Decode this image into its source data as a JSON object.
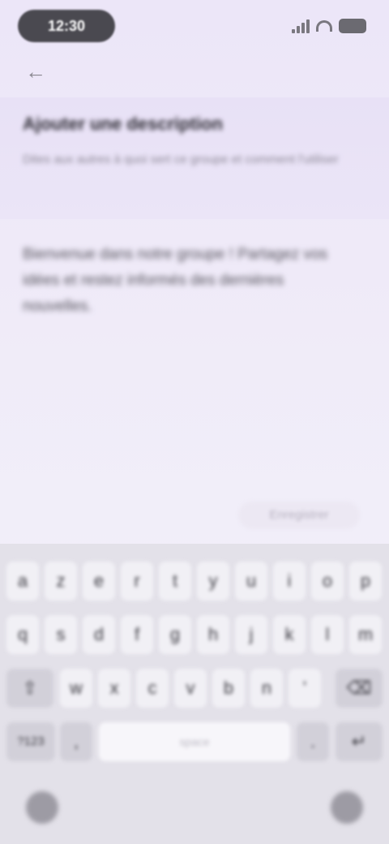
{
  "status_bar": {
    "time": "12:30"
  },
  "nav": {
    "back_glyph": "←"
  },
  "header": {
    "title": "Ajouter une description",
    "subtitle": "Dites aux autres à quoi sert ce groupe et comment l'utiliser"
  },
  "editor": {
    "text": "Bienvenue dans notre groupe ! Partagez vos idées et restez informés des dernières nouvelles."
  },
  "actions": {
    "save_label": "Enregistrer"
  },
  "keyboard": {
    "row1": [
      "a",
      "z",
      "e",
      "r",
      "t",
      "y",
      "u",
      "i",
      "o",
      "p"
    ],
    "row2": [
      "q",
      "s",
      "d",
      "f",
      "g",
      "h",
      "j",
      "k",
      "l",
      "m"
    ],
    "row3": [
      "⇧",
      "w",
      "x",
      "c",
      "v",
      "b",
      "n",
      "'",
      "⌫"
    ],
    "row4": [
      "?123",
      ",",
      "space",
      ".",
      "↵"
    ]
  },
  "icons": {
    "keyboard_hide": "keyboard-down-icon",
    "emoji": "emoji-icon"
  }
}
